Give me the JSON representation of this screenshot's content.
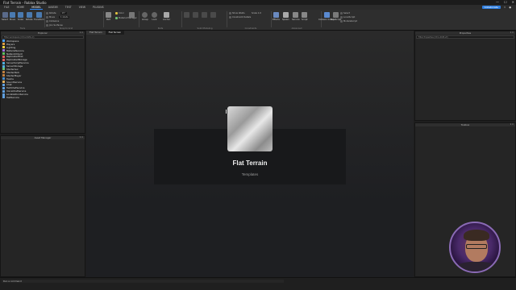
{
  "window": {
    "title": "Flat Terrain - Roblox Studio",
    "controls": [
      "—",
      "☐",
      "✕"
    ]
  },
  "menu": {
    "file": "FILE",
    "tabs": [
      "HOME",
      "MODEL",
      "AVATAR",
      "TEST",
      "VIEW",
      "PLUGINS"
    ],
    "active_tab": "MODEL",
    "collaborate": "Collaborate"
  },
  "ribbon": {
    "tools": [
      "Select",
      "Move",
      "Scale",
      "Rotate",
      "Transform"
    ],
    "tools_label": "Tools",
    "snap_label": "Snap to Grid",
    "snap_options": [
      "Rotate",
      "Move",
      "Collisions",
      "Join Surfaces"
    ],
    "rotate_value": "15°",
    "move_value": "1 studs",
    "part_label": "Part",
    "material_label": "Material Manager",
    "color_label": "Color",
    "group_label": "Group",
    "lock_label": "Lock",
    "anchor_label": "Anchor",
    "parts_label": "Parts",
    "solid_label": "Solid Modeling",
    "constraints_label": "Constraints",
    "constraint_opts": [
      "Show Welds",
      "Constraint Details",
      "Scale 1.0"
    ],
    "effects_label": "Effects",
    "spawn_label": "Spawn",
    "advanced_label": "Advanced",
    "advanced_items": [
      "Effects",
      "Spawn",
      "Service",
      "Script"
    ],
    "collision_groups": "Collision Groups",
    "run_script": "Run Script",
    "model_items": [
      "Select",
      "LocalScript",
      "ModuleScript"
    ]
  },
  "explorer": {
    "title": "Explorer",
    "filter": "Filter workspace (Ctrl+Shift+X)",
    "items": [
      {
        "label": "Workspace",
        "color": "#4aa3ff"
      },
      {
        "label": "Players",
        "color": "#e0a040"
      },
      {
        "label": "Lighting",
        "color": "#f0d040"
      },
      {
        "label": "MaterialService",
        "color": "#a070e0"
      },
      {
        "label": "NetworkClient",
        "color": "#60c060"
      },
      {
        "label": "ReplicatedFirst",
        "color": "#e06060"
      },
      {
        "label": "ReplicatedStorage",
        "color": "#e06060"
      },
      {
        "label": "ServerScriptService",
        "color": "#50b0e0"
      },
      {
        "label": "ServerStorage",
        "color": "#50b0e0"
      },
      {
        "label": "StarterGui",
        "color": "#70c070"
      },
      {
        "label": "StarterPack",
        "color": "#c08040"
      },
      {
        "label": "StarterPlayer",
        "color": "#c08040"
      },
      {
        "label": "Teams",
        "color": "#4a90d0"
      },
      {
        "label": "SoundService",
        "color": "#e0b060"
      },
      {
        "label": "Chat",
        "color": "#60a0e0"
      },
      {
        "label": "TextChatService",
        "color": "#60a0e0"
      },
      {
        "label": "VoiceChatService",
        "color": "#60a0e0"
      },
      {
        "label": "LocalizationService",
        "color": "#60a0e0"
      },
      {
        "label": "TestService",
        "color": "#60a0e0"
      }
    ]
  },
  "asset_panel": {
    "title": "Asset Manager"
  },
  "viewport": {
    "tabs": [
      "Flat Terrain",
      "Flat Terrain"
    ],
    "active_tab": 1
  },
  "template": {
    "title": "Flat Terrain",
    "subtitle": "Templates"
  },
  "properties": {
    "title": "Properties",
    "filter": "Filter Properties (Ctrl+Shift+P)"
  },
  "toolbox": {
    "title": "Toolbox"
  },
  "command_bar": {
    "text": "Run a command"
  }
}
